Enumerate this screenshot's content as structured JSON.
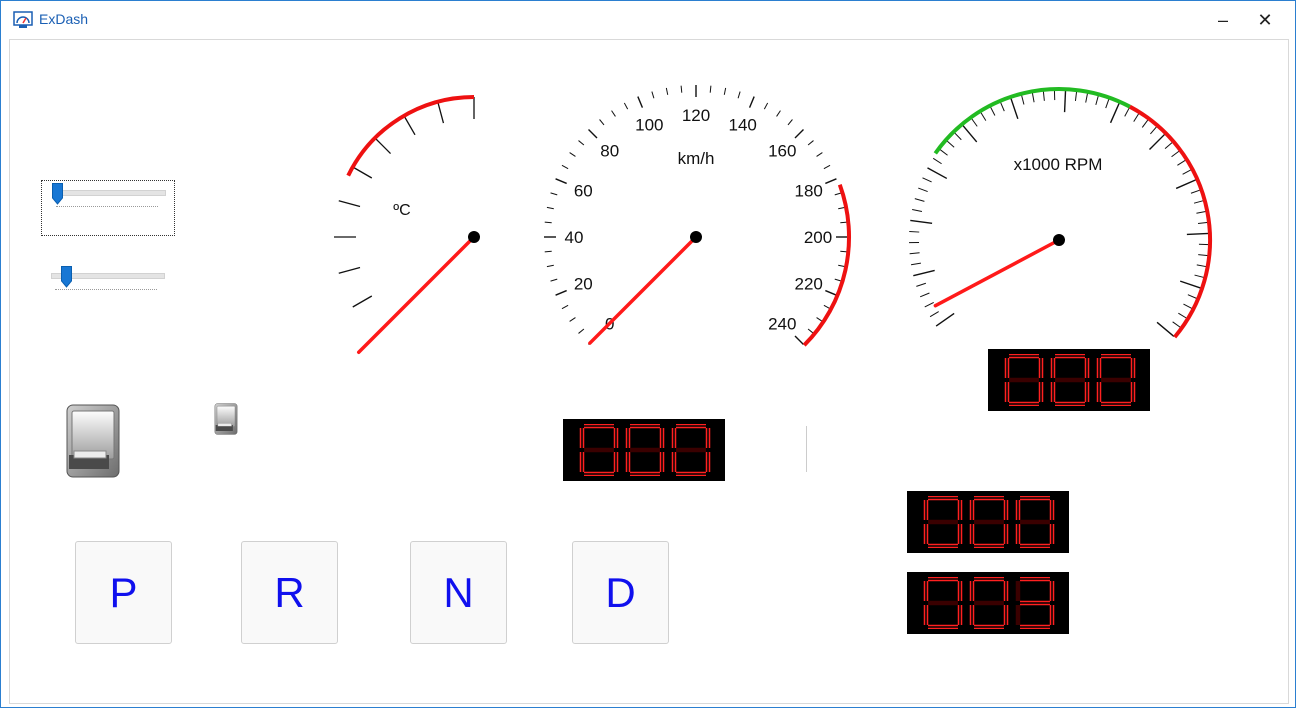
{
  "window": {
    "title": "ExDash",
    "minimize_glyph": "–",
    "close_glyph": "✕",
    "icon": "dashboard-app-icon"
  },
  "controls": {
    "trackbar_1": {
      "value_fraction": 0.0
    },
    "trackbar_2": {
      "value_fraction": 0.1
    },
    "large_switch": {
      "icon": "toggle-switch-icon"
    },
    "small_switch": {
      "icon": "toggle-switch-icon"
    }
  },
  "gauges": {
    "temperature": {
      "unit": "ºC",
      "needle_fraction": 0.0
    },
    "speed": {
      "unit": "km/h",
      "labels": [
        "0",
        "20",
        "40",
        "60",
        "80",
        "100",
        "120",
        "140",
        "160",
        "180",
        "200",
        "220",
        "240"
      ],
      "value": 0
    },
    "rpm": {
      "unit": "x1000 RPM",
      "needle_fraction": 0.0
    }
  },
  "displays": {
    "speed_display": "000",
    "rpm_display": "000",
    "display_3": "000",
    "display_4": "003"
  },
  "gear_buttons": [
    {
      "label": "P"
    },
    {
      "label": "R"
    },
    {
      "label": "N"
    },
    {
      "label": "D"
    }
  ],
  "colors": {
    "needle": "#ff1a1a",
    "red_zone": "#ee1111",
    "green_zone": "#22bb22",
    "gear_text": "#1010ee",
    "segment_on": "#ff2020",
    "segment_off": "#3a0000",
    "title_text": "#1a5fb4"
  }
}
